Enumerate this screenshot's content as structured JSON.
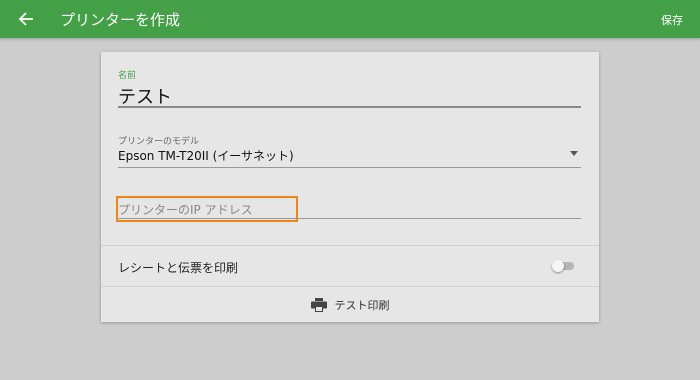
{
  "appbar": {
    "title": "プリンターを作成",
    "save_label": "保存",
    "color": "#43a047"
  },
  "form": {
    "name_label": "名前",
    "name_value": "テスト",
    "model_label": "プリンターのモデル",
    "model_value": "Epson TM-T20II (イーサネット)",
    "ip_placeholder": "プリンターのIP アドレス",
    "receipt_label": "レシートと伝票を印刷",
    "receipt_toggle_on": false,
    "test_print_label": "テスト印刷"
  },
  "icons": {
    "back": "arrow-left-icon",
    "dropdown": "dropdown-arrow-icon",
    "print": "printer-icon"
  },
  "highlight_color": "#f0850f"
}
